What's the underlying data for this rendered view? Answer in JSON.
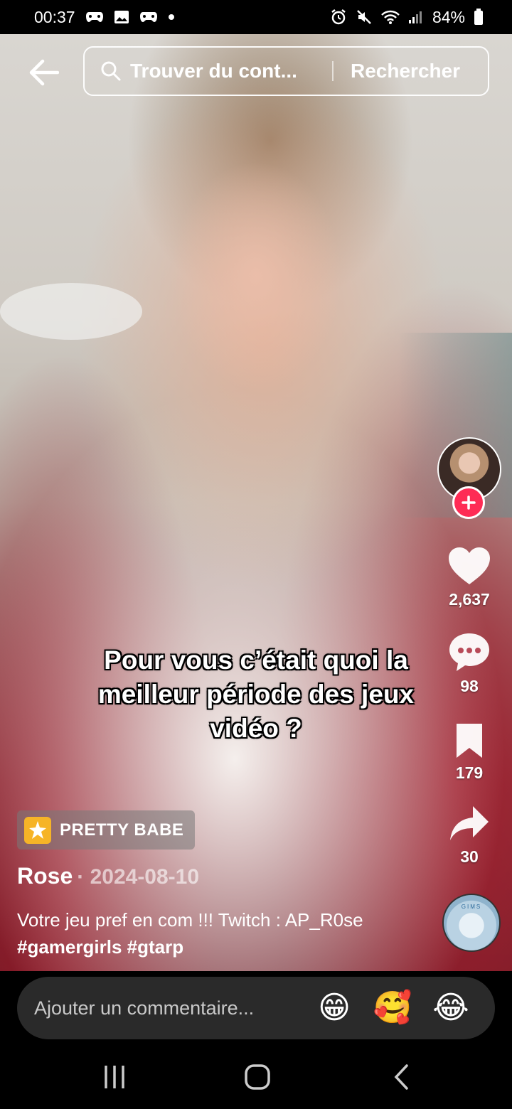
{
  "status_bar": {
    "time": "00:37",
    "battery": "84%",
    "left_icons": [
      "game-controller-icon",
      "image-icon",
      "game-controller-icon",
      "dot-icon"
    ],
    "right_icons": [
      "alarm-icon",
      "mute-icon",
      "wifi-icon",
      "signal-icon",
      "battery-icon"
    ]
  },
  "search": {
    "placeholder": "Trouver du cont...",
    "action_label": "Rechercher"
  },
  "video": {
    "caption": "Pour vous c’était quoi la meilleur période des jeux vidéo ?"
  },
  "rail": {
    "likes": "2,637",
    "comments": "98",
    "saves": "179",
    "shares": "30",
    "music_disc_text": "GIMS"
  },
  "effect": {
    "label": "PRETTY BABE"
  },
  "author": {
    "name": "Rose",
    "date": "· 2024-08-10"
  },
  "description": {
    "text": "Votre jeu pref en com !!! Twitch : AP_R0se",
    "hashtags": [
      "#gamergirls",
      "#gtarp"
    ]
  },
  "comment": {
    "placeholder": "Ajouter un commentaire...",
    "emojis": [
      "😁",
      "🥰",
      "😂"
    ]
  },
  "colors": {
    "accent": "#fe2c55",
    "effect_icon": "#f6b427"
  }
}
